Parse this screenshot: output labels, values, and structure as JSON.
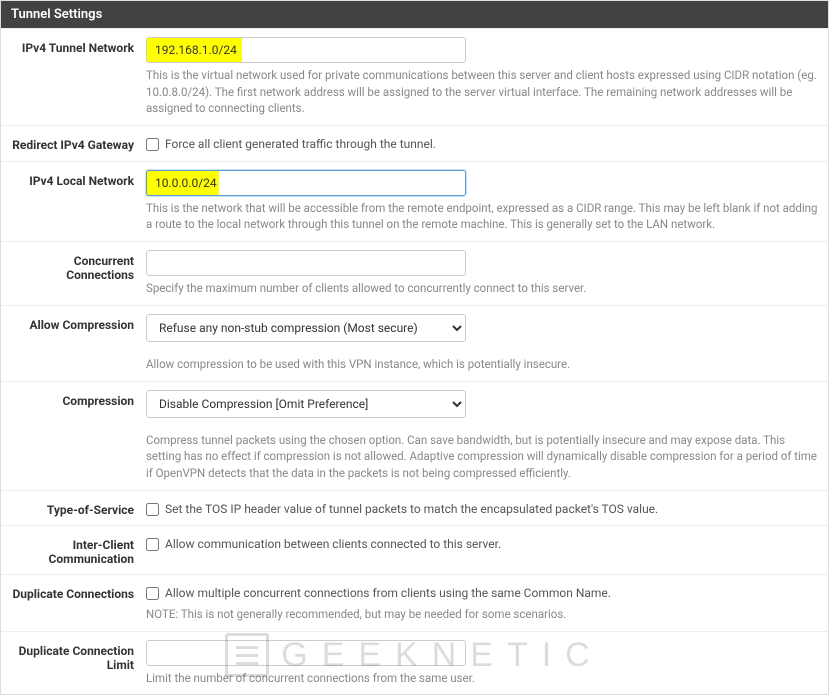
{
  "panel": {
    "title": "Tunnel Settings"
  },
  "ipv4_tunnel": {
    "label": "IPv4 Tunnel Network",
    "value": "192.168.1.0/24",
    "help": "This is the virtual network used for private communications between this server and client hosts expressed using CIDR notation (eg. 10.0.8.0/24). The first network address will be assigned to the server virtual interface. The remaining network addresses will be assigned to connecting clients."
  },
  "redirect_gateway": {
    "label": "Redirect IPv4 Gateway",
    "checkbox_label": "Force all client generated traffic through the tunnel."
  },
  "ipv4_local": {
    "label": "IPv4 Local Network",
    "value": "10.0.0.0/24",
    "help": "This is the network that will be accessible from the remote endpoint, expressed as a CIDR range. This may be left blank if not adding a route to the local network through this tunnel on the remote machine. This is generally set to the LAN network."
  },
  "concurrent": {
    "label": "Concurrent Connections",
    "value": "",
    "help": "Specify the maximum number of clients allowed to concurrently connect to this server."
  },
  "allow_compression": {
    "label": "Allow Compression",
    "selected": "Refuse any non-stub compression (Most secure)",
    "help": "Allow compression to be used with this VPN instance, which is potentially insecure."
  },
  "compression": {
    "label": "Compression",
    "selected": "Disable Compression [Omit Preference]",
    "help": "Compress tunnel packets using the chosen option. Can save bandwidth, but is potentially insecure and may expose data. This setting has no effect if compression is not allowed. Adaptive compression will dynamically disable compression for a period of time if OpenVPN detects that the data in the packets is not being compressed efficiently."
  },
  "tos": {
    "label": "Type-of-Service",
    "checkbox_label": "Set the TOS IP header value of tunnel packets to match the encapsulated packet's TOS value."
  },
  "inter_client": {
    "label": "Inter-Client Communication",
    "checkbox_label": "Allow communication between clients connected to this server."
  },
  "duplicate": {
    "label": "Duplicate Connections",
    "checkbox_label": "Allow multiple concurrent connections from clients using the same Common Name.",
    "note": "NOTE: This is not generally recommended, but may be needed for some scenarios."
  },
  "duplicate_limit": {
    "label": "Duplicate Connection Limit",
    "value": "",
    "help": "Limit the number of concurrent connections from the same user."
  },
  "watermark": "GEEKNETIC"
}
